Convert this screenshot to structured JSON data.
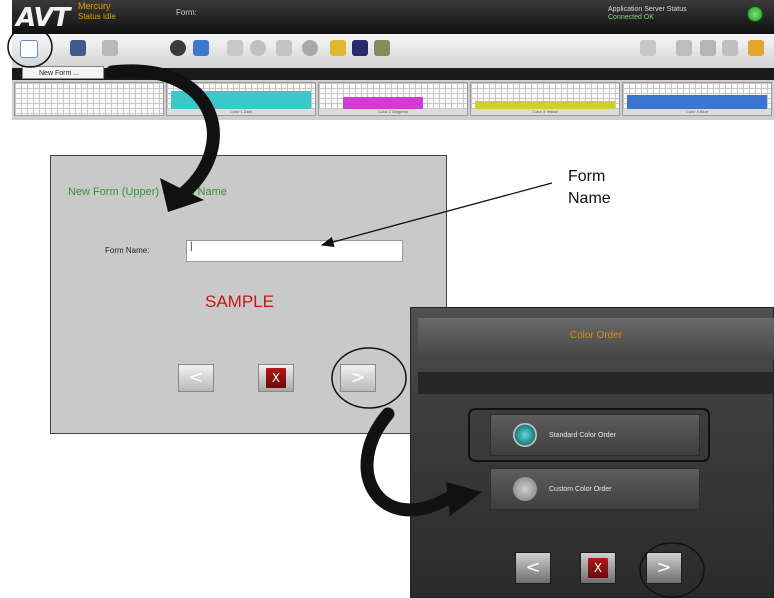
{
  "app": {
    "logo": "AVT",
    "name": "Mercury",
    "status": "Status Idle",
    "form_label": "Form:",
    "server_status": "Application Server Status",
    "server_connection": "Connected OK",
    "menu_item": "New Form ...",
    "panels": [
      {
        "label": "Color 1 Dark",
        "color": "#3cc8c8"
      },
      {
        "label": "Color 2 Magenta",
        "color": "#d23cd2"
      },
      {
        "label": "Color 3 Yellow",
        "color": "#d2cf2c"
      },
      {
        "label": "Color 4 Blue",
        "color": "#3c74d2"
      }
    ]
  },
  "form_dialog": {
    "title": "New Form (Upper) - Form Name",
    "field_label": "Form Name:",
    "field_value": "|",
    "watermark": "SAMPLE",
    "back_glyph": "<",
    "cancel_glyph": "X",
    "next_glyph": ">"
  },
  "color_dialog": {
    "title": "Color Order",
    "options": [
      {
        "label": "Standard Color Order",
        "selected": true
      },
      {
        "label": "Custom Color Order",
        "selected": false
      }
    ],
    "back_glyph": "<",
    "cancel_glyph": "X",
    "next_glyph": ">"
  },
  "callout": {
    "line1": "Form",
    "line2": "Name"
  },
  "colors": {
    "accent_green": "#3c8f3c",
    "sample_red": "#c21818",
    "title_orange": "#e08a10"
  }
}
